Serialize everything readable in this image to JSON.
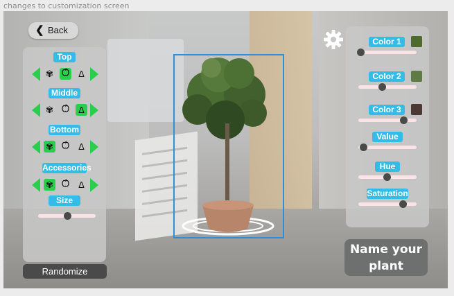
{
  "caption": "changes to customization screen",
  "back": {
    "label": "Back"
  },
  "left": {
    "sections": [
      {
        "label": "Top",
        "selected": 1
      },
      {
        "label": "Middle",
        "selected": 2
      },
      {
        "label": "Bottom",
        "selected": 0
      },
      {
        "label": "Accessories",
        "selected": 0
      }
    ],
    "size": {
      "label": "Size",
      "value": 0.5
    }
  },
  "randomize": {
    "label": "Randomize"
  },
  "right": {
    "colors": [
      {
        "label": "Color 1",
        "swatch": "#4d6b2f",
        "value": 0.0
      },
      {
        "label": "Color 2",
        "swatch": "#5f7a45",
        "value": 0.4
      },
      {
        "label": "Color 3",
        "swatch": "#4a3a33",
        "value": 0.82
      }
    ],
    "value": {
      "label": "Value",
      "value": 0.05
    },
    "hue": {
      "label": "Hue",
      "value": 0.5
    },
    "saturation": {
      "label": "Saturation",
      "value": 0.8
    }
  },
  "name": {
    "line1": "Name your",
    "line2": "plant"
  },
  "icons": {
    "options": [
      "flower-icon",
      "apple-icon",
      "vase-icon"
    ],
    "settings": "gear-icon"
  },
  "colors": {
    "accent": "#33bde6",
    "arrow": "#29cf4c",
    "frame": "#2f8ed8"
  }
}
